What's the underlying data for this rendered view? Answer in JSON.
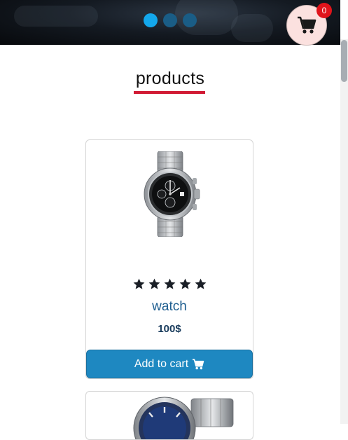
{
  "header": {
    "carousel_dots": [
      {
        "active": true
      },
      {
        "active": false
      },
      {
        "active": false
      }
    ],
    "cart_count": "0",
    "colors": {
      "active_dot": "#13a7ec",
      "dot": "#1a5d86",
      "cart_bg": "#fbe1df",
      "badge": "#e0141b"
    }
  },
  "section": {
    "title": "products",
    "underline_color": "#d11a34"
  },
  "products": [
    {
      "name": "watch",
      "price": "100$",
      "rating": 5,
      "button_label": "Add to cart",
      "image_icon": "wristwatch-silver-black-dial"
    },
    {
      "image_icon": "wristwatch-silver-blue-dial"
    }
  ],
  "colors": {
    "button": "#1e88c1",
    "product_name": "#1d5d8f"
  }
}
